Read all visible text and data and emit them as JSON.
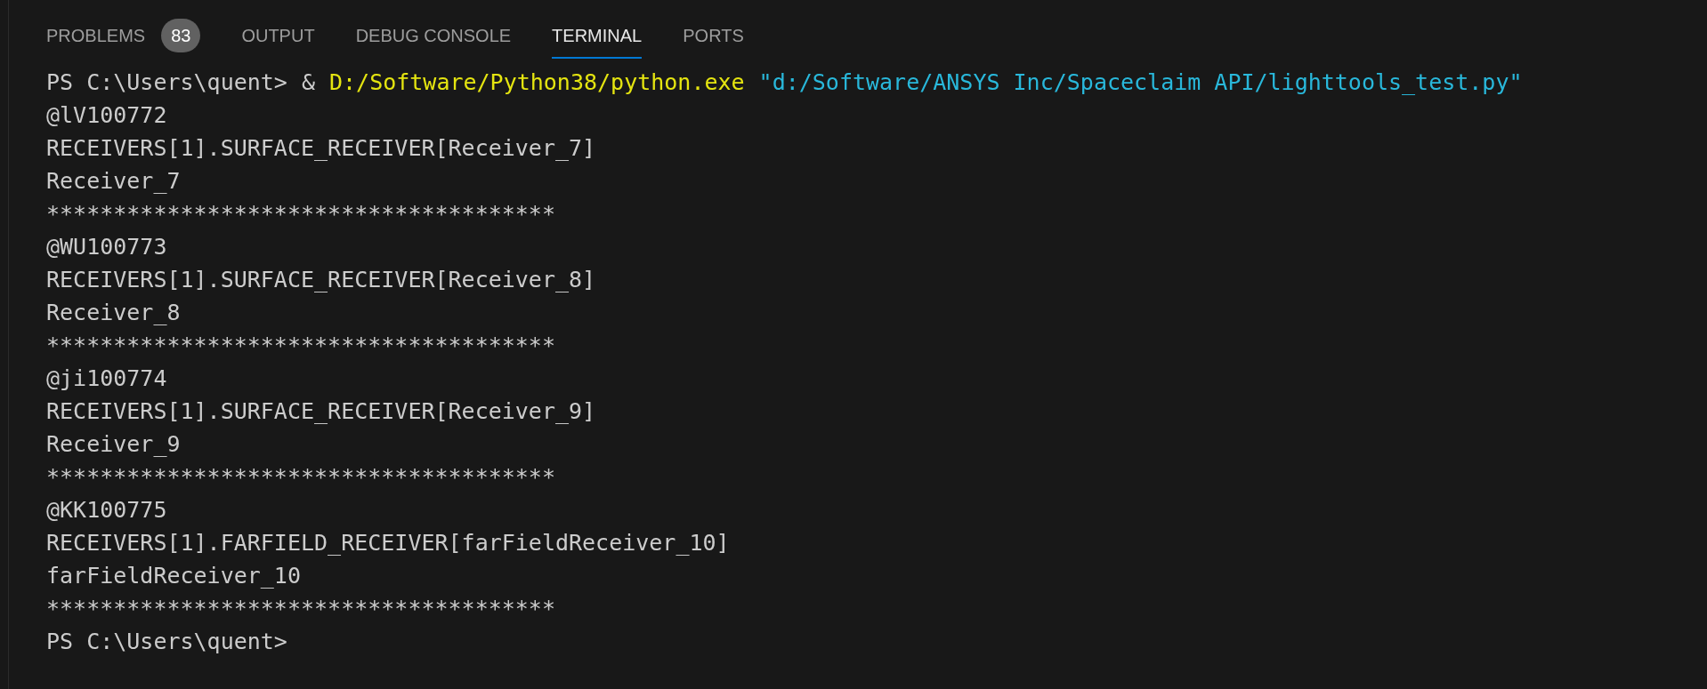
{
  "tabs": [
    {
      "label": "PROBLEMS",
      "badge": "83",
      "selected": false
    },
    {
      "label": "OUTPUT",
      "selected": false
    },
    {
      "label": "DEBUG CONSOLE",
      "selected": false
    },
    {
      "label": "TERMINAL",
      "selected": true
    },
    {
      "label": "PORTS",
      "selected": false
    }
  ],
  "terminal": {
    "lines": [
      {
        "kind": "command",
        "prompt": "PS C:\\Users\\quent>",
        "operator": "&",
        "executable": "D:/Software/Python38/python.exe",
        "argument": "\"d:/Software/ANSYS Inc/Spaceclaim API/lighttools_test.py\""
      },
      {
        "kind": "output",
        "text": "@lV100772"
      },
      {
        "kind": "output",
        "text": "RECEIVERS[1].SURFACE_RECEIVER[Receiver_7]"
      },
      {
        "kind": "output",
        "text": "Receiver_7"
      },
      {
        "kind": "output",
        "text": "**************************************"
      },
      {
        "kind": "output",
        "text": "@WU100773"
      },
      {
        "kind": "output",
        "text": "RECEIVERS[1].SURFACE_RECEIVER[Receiver_8]"
      },
      {
        "kind": "output",
        "text": "Receiver_8"
      },
      {
        "kind": "output",
        "text": "**************************************"
      },
      {
        "kind": "output",
        "text": "@ji100774"
      },
      {
        "kind": "output",
        "text": "RECEIVERS[1].SURFACE_RECEIVER[Receiver_9]"
      },
      {
        "kind": "output",
        "text": "Receiver_9"
      },
      {
        "kind": "output",
        "text": "**************************************"
      },
      {
        "kind": "output",
        "text": "@KK100775"
      },
      {
        "kind": "output",
        "text": "RECEIVERS[1].FARFIELD_RECEIVER[farFieldReceiver_10]"
      },
      {
        "kind": "output",
        "text": "farFieldReceiver_10"
      },
      {
        "kind": "output",
        "text": "**************************************"
      },
      {
        "kind": "prompt",
        "prompt": "PS C:\\Users\\quent>"
      }
    ]
  }
}
